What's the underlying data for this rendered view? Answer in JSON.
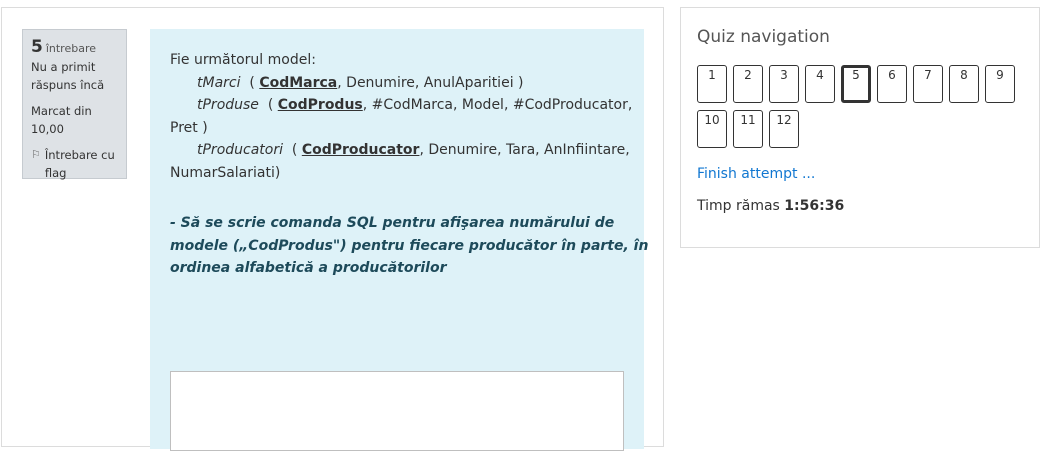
{
  "question_info": {
    "number": "5",
    "word": "întrebare",
    "state": "Nu a primit răspuns încă",
    "grade": "Marcat din 10,00",
    "flag_label": "Întrebare cu flag"
  },
  "question": {
    "intro": "Fie următorul model:",
    "t1_name": "tMarci",
    "t1_key": "CodMarca",
    "t1_rest": ", Denumire, AnulAparitiei )",
    "t2_name": "tProduse",
    "t2_key": "CodProdus",
    "t2_rest": ",  #CodMarca,  Model,  #CodProducator,",
    "t2_cont": "Pret )",
    "t3_name": "tProducatori",
    "t3_key": "CodProducator",
    "t3_rest": ",  Denumire, Tara,  AnInfiintare,",
    "t3_cont": "NumarSalariati)",
    "task_line1": "-  Să se scrie comanda SQL  pentru afişarea numărului de",
    "task_line2": "modele („CodProdus\") pentru fiecare producător în parte, în",
    "task_line3": "ordinea alfabetică a producătorilor"
  },
  "nav": {
    "title": "Quiz navigation",
    "buttons": [
      "1",
      "2",
      "3",
      "4",
      "5",
      "6",
      "7",
      "8",
      "9",
      "10",
      "11",
      "12"
    ],
    "current": "5",
    "finish_label": "Finish attempt ...",
    "timer_label": "Timp rămas",
    "timer_value": "1:56:36"
  }
}
